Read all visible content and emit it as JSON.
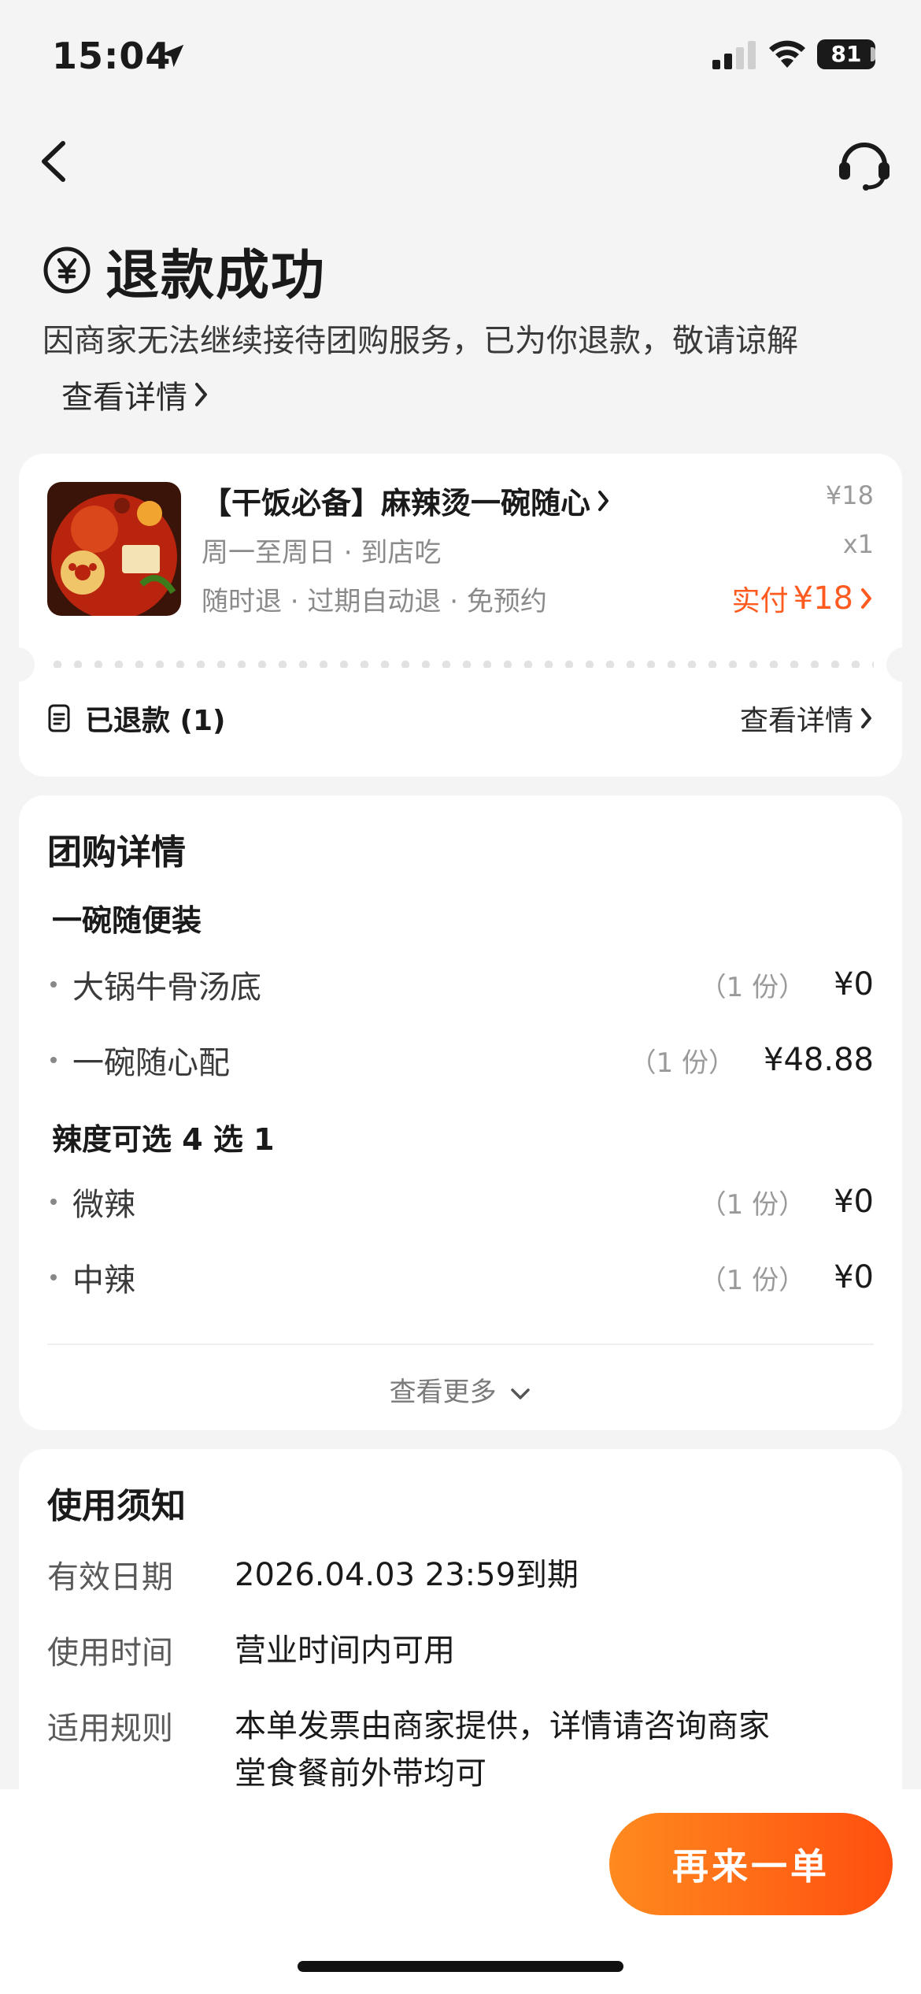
{
  "status_bar": {
    "time": "15:04",
    "battery": "81"
  },
  "header": {
    "title": "退款成功",
    "description": "因商家无法继续接待团购服务，已为你退款，敬请谅解",
    "detail_link": "查看详情"
  },
  "order": {
    "product_name": "【干饭必备】麻辣烫一碗随心",
    "sub1": "周一至周日 · 到店吃",
    "sub2": "随时退 · 过期自动退 · 免预约",
    "price": "¥18",
    "qty": "x1",
    "paid_label": "实付",
    "paid_value": "¥18",
    "refunded_label": "已退款 (1)",
    "view_detail": "查看详情"
  },
  "group_detail": {
    "title": "团购详情",
    "sections": [
      {
        "name": "一碗随便装",
        "items": [
          {
            "name": "大锅牛骨汤底",
            "count": "（1 份）",
            "price": "¥0"
          },
          {
            "name": "一碗随心配",
            "count": "（1 份）",
            "price": "¥48.88"
          }
        ]
      },
      {
        "name": "辣度可选 4 选 1",
        "items": [
          {
            "name": "微辣",
            "count": "（1 份）",
            "price": "¥0"
          },
          {
            "name": "中辣",
            "count": "（1 份）",
            "price": "¥0"
          }
        ]
      }
    ],
    "more": "查看更多"
  },
  "notice": {
    "title": "使用须知",
    "rows": [
      {
        "label": "有效日期",
        "value": "2026.04.03 23:59到期"
      },
      {
        "label": "使用时间",
        "value": "营业时间内可用"
      },
      {
        "label": "适用规则",
        "value": "本单发票由商家提供，详情请咨询商家",
        "value2": "堂食餐前外带均可"
      }
    ]
  },
  "bottom": {
    "reorder": "再来一单"
  },
  "colors": {
    "accent": "#ff5a1f",
    "button_start": "#ff8a1f",
    "button_end": "#ff4f0f"
  }
}
